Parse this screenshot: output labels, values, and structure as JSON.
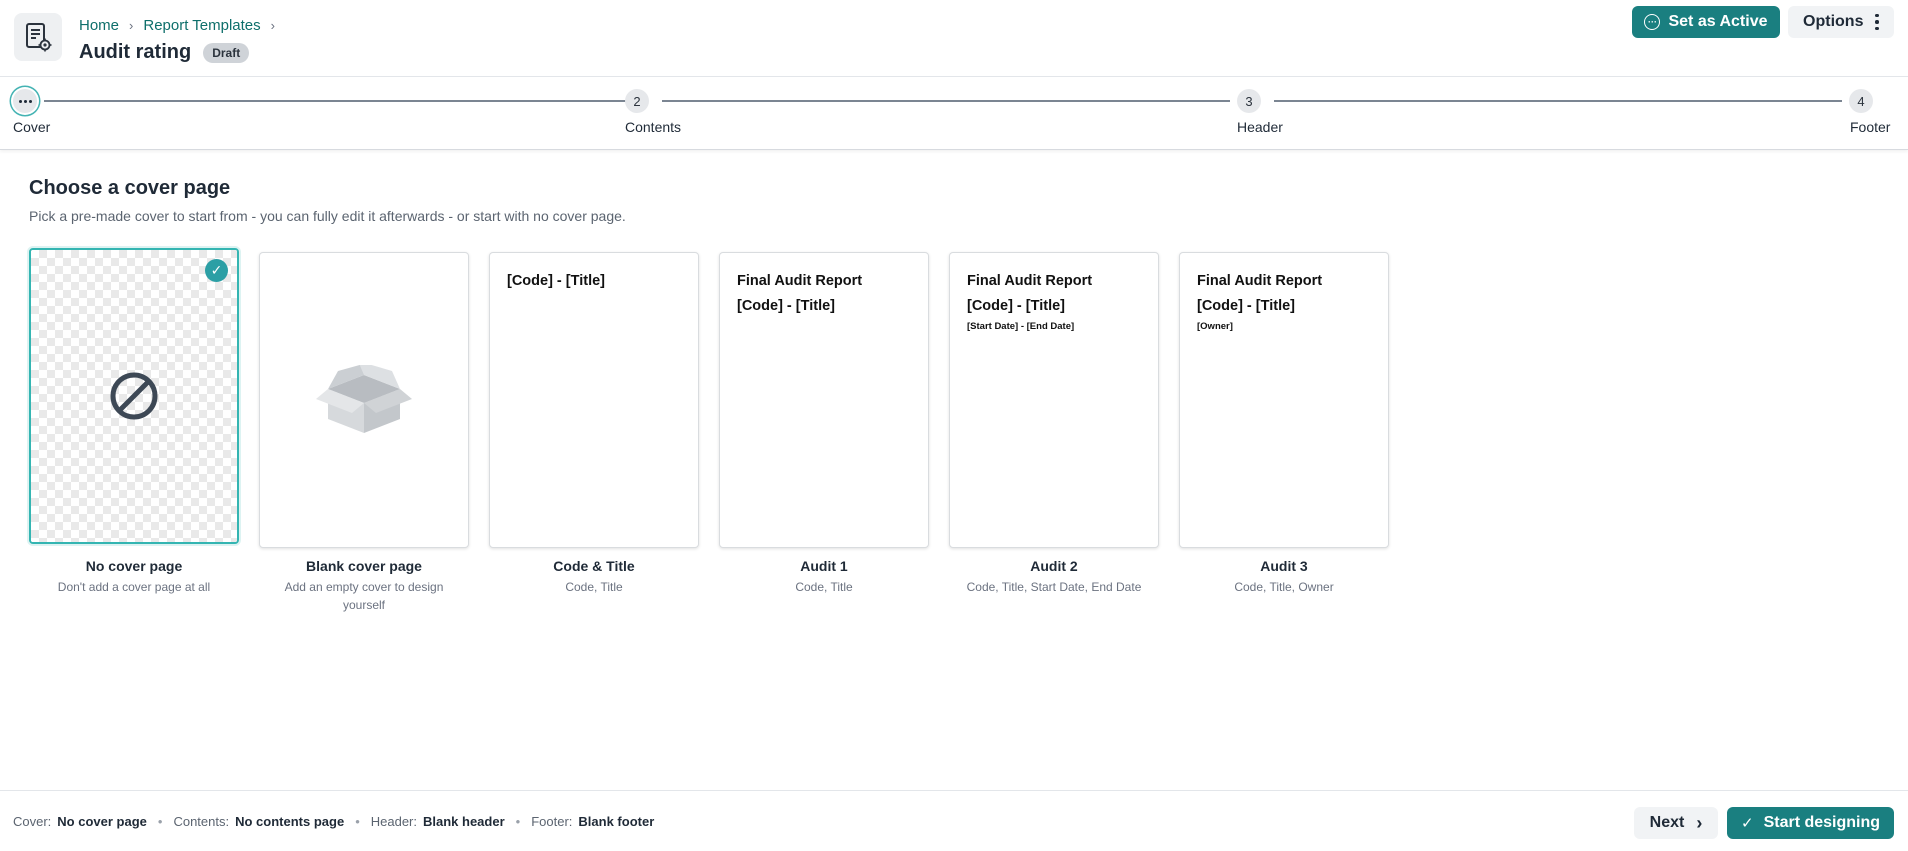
{
  "header": {
    "breadcrumb": [
      {
        "label": "Home"
      },
      {
        "label": "Report Templates"
      }
    ],
    "title": "Audit rating",
    "status_badge": "Draft",
    "set_active_label": "Set as Active",
    "options_label": "Options"
  },
  "stepper": {
    "steps": [
      {
        "number": "",
        "label": "Cover",
        "state": "active"
      },
      {
        "number": "2",
        "label": "Contents",
        "state": "pending"
      },
      {
        "number": "3",
        "label": "Header",
        "state": "pending"
      },
      {
        "number": "4",
        "label": "Footer",
        "state": "pending"
      }
    ]
  },
  "main": {
    "title": "Choose a cover page",
    "subtitle": "Pick a pre-made cover to start from - you can fully edit it afterwards - or start with no cover page.",
    "covers": [
      {
        "name": "No cover page",
        "description": "Don't add a cover page at all",
        "selected": true,
        "icon": "no-symbol-icon",
        "preview": []
      },
      {
        "name": "Blank cover page",
        "description": "Add an empty cover to design yourself",
        "selected": false,
        "icon": "open-box-icon",
        "preview": []
      },
      {
        "name": "Code & Title",
        "description": "Code, Title",
        "selected": false,
        "preview": [
          "[Code] - [Title]"
        ]
      },
      {
        "name": "Audit 1",
        "description": "Code, Title",
        "selected": false,
        "preview": [
          "Final Audit Report",
          "[Code] - [Title]"
        ]
      },
      {
        "name": "Audit 2",
        "description": "Code, Title, Start Date, End Date",
        "selected": false,
        "preview": [
          "Final Audit Report",
          "[Code] - [Title]"
        ],
        "preview_small": "[Start Date] - [End Date]"
      },
      {
        "name": "Audit 3",
        "description": "Code, Title, Owner",
        "selected": false,
        "preview": [
          "Final Audit Report",
          "[Code] - [Title]"
        ],
        "preview_small": "[Owner]"
      }
    ]
  },
  "footer": {
    "summary": [
      {
        "key": "Cover:",
        "value": "No cover page"
      },
      {
        "key": "Contents:",
        "value": "No contents page"
      },
      {
        "key": "Header:",
        "value": "Blank header"
      },
      {
        "key": "Footer:",
        "value": "Blank footer"
      }
    ],
    "next_label": "Next",
    "start_label": "Start designing"
  },
  "colors": {
    "primary": "#1a7f80",
    "selected_border": "#34b5b2",
    "link": "#0e6f6b"
  }
}
